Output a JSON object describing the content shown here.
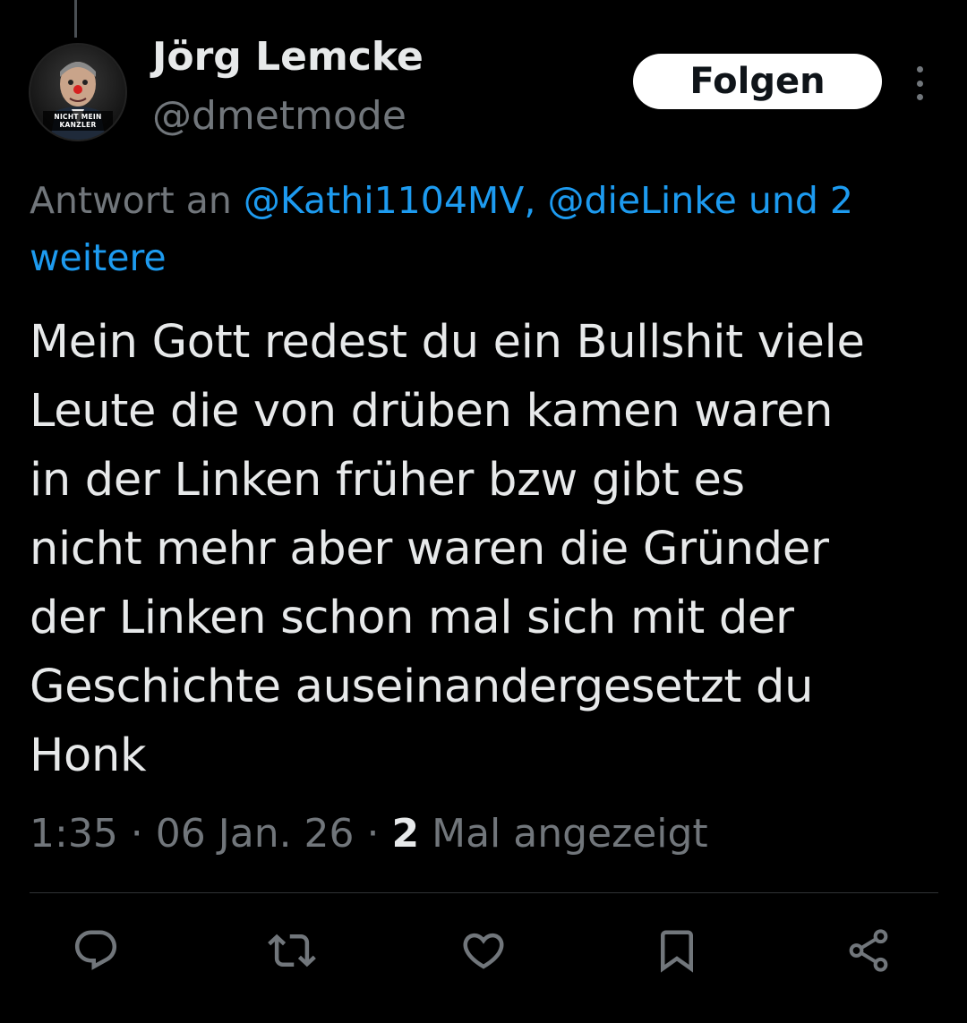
{
  "author": {
    "display_name": "Jörg Lemcke",
    "handle": "@dmetmode",
    "avatar_caption_line1": "NICHT MEIN",
    "avatar_caption_line2": "KANZLER"
  },
  "follow_button": {
    "label": "Folgen"
  },
  "reply_to": {
    "prefix": "Antwort an ",
    "mention1": "@Kathi1104MV,",
    "mention2": "@dieLinke",
    "connector": " und 2",
    "more": "weitere"
  },
  "tweet": {
    "lines": [
      "Mein Gott redest du ein Bullshit viele",
      "Leute die von drüben kamen waren",
      "in der Linken früher bzw gibt es",
      "nicht mehr aber waren die Gründer",
      "der Linken schon mal sich mit der",
      "Geschichte auseinandergesetzt du",
      "Honk"
    ]
  },
  "meta": {
    "time": "1:35",
    "sep": " · ",
    "date": "06 Jan. 26",
    "views_count": "2",
    "views_label": " Mal angezeigt"
  },
  "actions": [
    {
      "icon": "reply-icon"
    },
    {
      "icon": "retweet-icon"
    },
    {
      "icon": "like-icon"
    },
    {
      "icon": "bookmark-icon"
    },
    {
      "icon": "share-icon"
    }
  ],
  "colors": {
    "background": "#000000",
    "text": "#e7e9ea",
    "muted": "#71767b",
    "link": "#1d9bf0",
    "divider": "#2f3336"
  }
}
